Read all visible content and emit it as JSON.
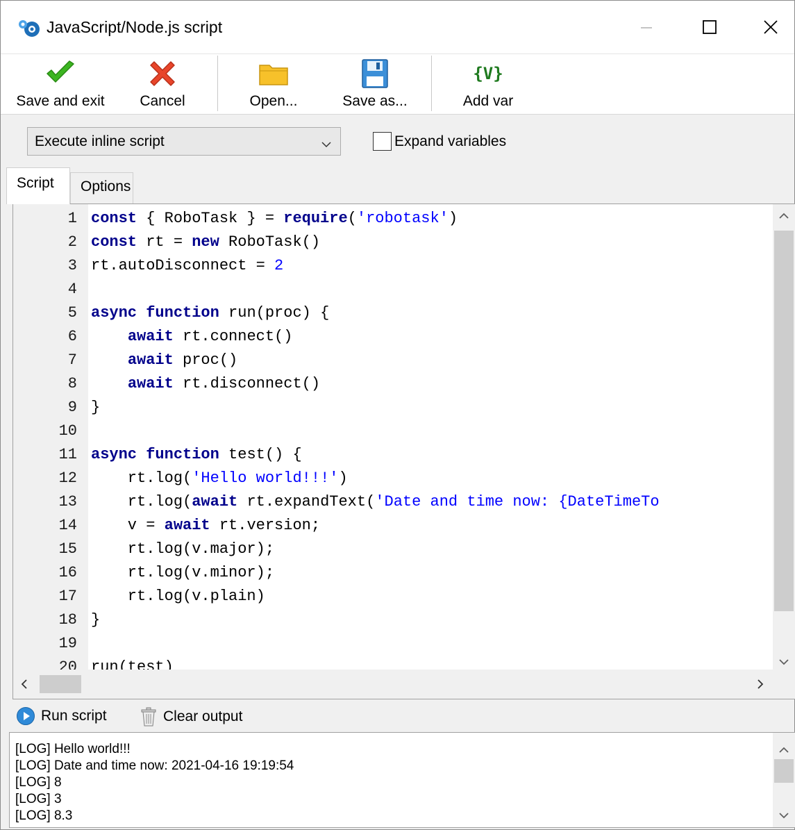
{
  "window": {
    "title": "JavaScript/Node.js script",
    "minimize_icon": "minimize-icon",
    "maximize_icon": "maximize-icon",
    "close_icon": "close-icon"
  },
  "toolbar": {
    "save_exit_label": "Save and exit",
    "cancel_label": "Cancel",
    "open_label": "Open...",
    "save_as_label": "Save as...",
    "add_var_label": "Add var",
    "add_var_icon_text": "{V}"
  },
  "options": {
    "mode_selected": "Execute inline script",
    "expand_variables_label": "Expand variables",
    "expand_variables_checked": false
  },
  "tabs": [
    {
      "label": "Script",
      "active": true
    },
    {
      "label": "Options",
      "active": false
    }
  ],
  "editor": {
    "line_numbers": [
      "1",
      "2",
      "3",
      "4",
      "5",
      "6",
      "7",
      "8",
      "9",
      "10",
      "11",
      "12",
      "13",
      "14",
      "15",
      "16",
      "17",
      "18",
      "19",
      "20"
    ],
    "lines": [
      "const { RoboTask } = require('robotask')",
      "const rt = new RoboTask()",
      "rt.autoDisconnect = 2",
      "",
      "async function run(proc) {",
      "    await rt.connect()",
      "    await proc()",
      "    await rt.disconnect()",
      "}",
      "",
      "async function test() {",
      "    rt.log('Hello world!!!')",
      "    rt.log(await rt.expandText('Date and time now: {DateTimeTo",
      "    v = await rt.version;",
      "    rt.log(v.major);",
      "    rt.log(v.minor);",
      "    rt.log(v.plain)",
      "}",
      "",
      "run(test)"
    ]
  },
  "runbar": {
    "run_label": "Run script",
    "clear_label": "Clear output"
  },
  "output": {
    "lines": [
      "[LOG] Hello world!!!",
      "[LOG] Date and time now: 2021-04-16 19:19:54",
      "[LOG] 8",
      "[LOG] 3",
      "[LOG] 8.3"
    ]
  },
  "colors": {
    "keyword": "#00008b",
    "string": "#0000ff",
    "check_green": "#3cb521",
    "cancel_red": "#e8452a",
    "folder_yellow": "#f7c12a",
    "save_blue": "#3c8fd8",
    "var_green": "#1f7a1f"
  }
}
